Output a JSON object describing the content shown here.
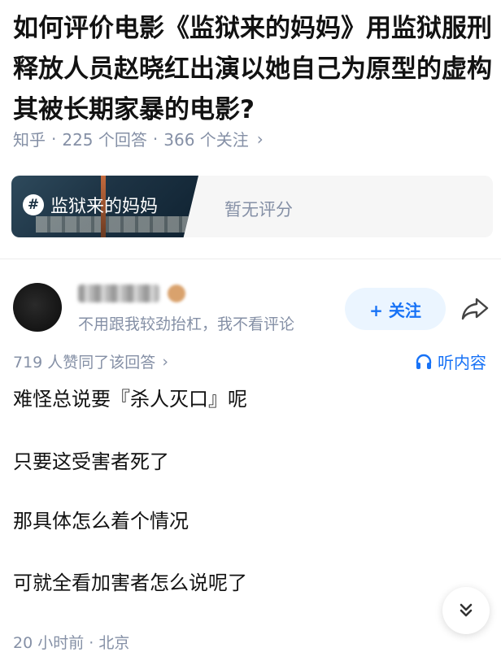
{
  "question": {
    "title": "如何评价电影《监狱来的妈妈》用监狱服刑释放人员赵晓红出演以她自己为原型的虚构其被长期家暴的电影?",
    "source": "知乎",
    "sep": "·",
    "answers": "225 个回答",
    "followers": "366 个关注",
    "chevron": "›"
  },
  "movie_card": {
    "tag": "监狱来的妈妈",
    "hash_symbol": "#",
    "rating": "暂无评分"
  },
  "author": {
    "bio": "不用跟我较劲抬杠，我不看评论",
    "follow_label": "+ 关注"
  },
  "answer": {
    "vote_text": "719 人赞同了该回答",
    "vote_chevron": "›",
    "listen_label": "听内容",
    "paragraphs": [
      "难怪总说要『杀人灭口』呢",
      "只要这受害者死了",
      "那具体怎么着个情况",
      "可就全看加害者怎么说呢了"
    ],
    "footer": "20 小时前 · 北京"
  },
  "colors": {
    "accent": "#1772f6",
    "muted": "#8590a6",
    "text": "#121212"
  },
  "icons": [
    "hash-icon",
    "share-icon",
    "headphones-icon",
    "double-chevron-down-icon"
  ]
}
